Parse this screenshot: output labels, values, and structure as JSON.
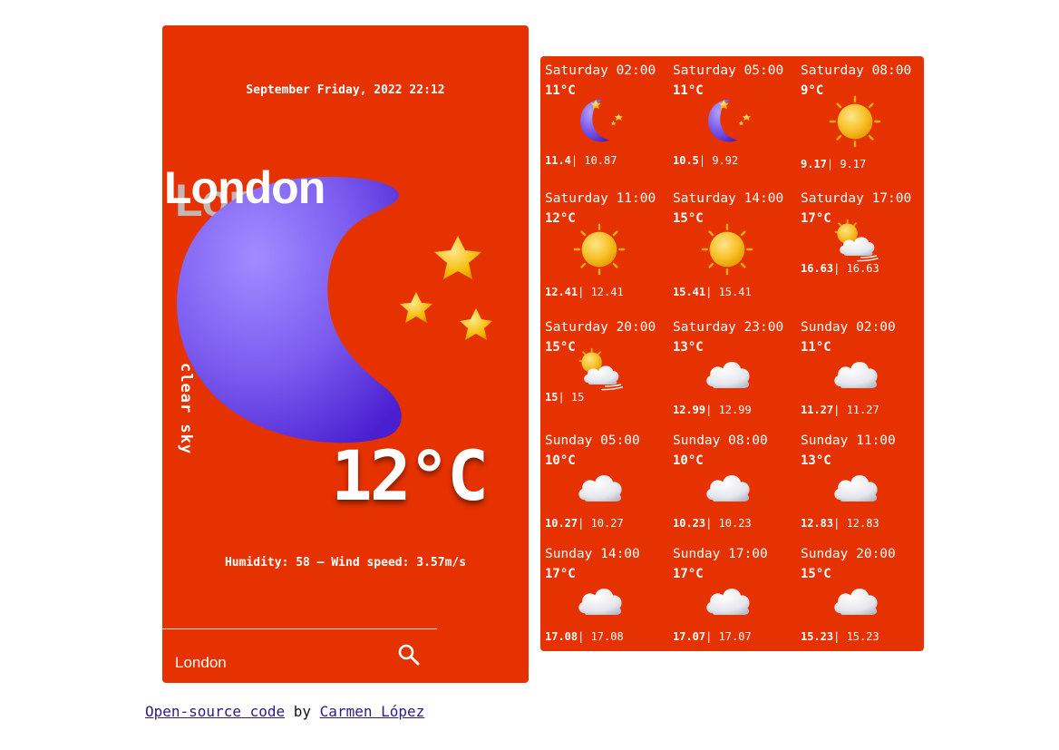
{
  "main": {
    "datetime": "September Friday, 2022 22:12",
    "city": "London",
    "condition": "clear sky",
    "temperature": "12°C",
    "meta": "Humidity: 58 — Wind speed: 3.57m/s",
    "search_value": "London",
    "main_icon": "moon-stars-icon",
    "search_icon": "search-icon"
  },
  "forecast": [
    {
      "time": "Saturday 02:00",
      "temp": "11°C",
      "max": "11.4",
      "min": "10.87",
      "icon": "moon-icon"
    },
    {
      "time": "Saturday 05:00",
      "temp": "11°C",
      "max": "10.5",
      "min": "9.92",
      "icon": "moon-icon"
    },
    {
      "time": "Saturday 08:00",
      "temp": "9°C",
      "max": "9.17",
      "min": "9.17",
      "icon": "sun-icon"
    },
    {
      "time": "Saturday 11:00",
      "temp": "12°C",
      "max": "12.41",
      "min": "12.41",
      "icon": "sun-icon"
    },
    {
      "time": "Saturday 14:00",
      "temp": "15°C",
      "max": "15.41",
      "min": "15.41",
      "icon": "sun-icon"
    },
    {
      "time": "Saturday 17:00",
      "temp": "17°C",
      "max": "16.63",
      "min": "16.63",
      "icon": "sun-cloud-wind-icon"
    },
    {
      "time": "Saturday 20:00",
      "temp": "15°C",
      "max": "15",
      "min": "15",
      "icon": "sun-cloud-wind-icon"
    },
    {
      "time": "Saturday 23:00",
      "temp": "13°C",
      "max": "12.99",
      "min": "12.99",
      "icon": "cloud-icon"
    },
    {
      "time": "Sunday 02:00",
      "temp": "11°C",
      "max": "11.27",
      "min": "11.27",
      "icon": "cloud-icon"
    },
    {
      "time": "Sunday 05:00",
      "temp": "10°C",
      "max": "10.27",
      "min": "10.27",
      "icon": "cloud-icon"
    },
    {
      "time": "Sunday 08:00",
      "temp": "10°C",
      "max": "10.23",
      "min": "10.23",
      "icon": "cloud-icon"
    },
    {
      "time": "Sunday 11:00",
      "temp": "13°C",
      "max": "12.83",
      "min": "12.83",
      "icon": "cloud-icon"
    },
    {
      "time": "Sunday 14:00",
      "temp": "17°C",
      "max": "17.08",
      "min": "17.08",
      "icon": "cloud-icon"
    },
    {
      "time": "Sunday 17:00",
      "temp": "17°C",
      "max": "17.07",
      "min": "17.07",
      "icon": "cloud-icon"
    },
    {
      "time": "Sunday 20:00",
      "temp": "15°C",
      "max": "15.23",
      "min": "15.23",
      "icon": "cloud-icon"
    }
  ],
  "footer": {
    "code_link": "Open-source code",
    "by": "by",
    "author_link": "Carmen López"
  },
  "colors": {
    "card": "#e63200",
    "moon": "#7b5ee6",
    "sun": "#f5b400",
    "cloud": "#e8e8ec"
  }
}
